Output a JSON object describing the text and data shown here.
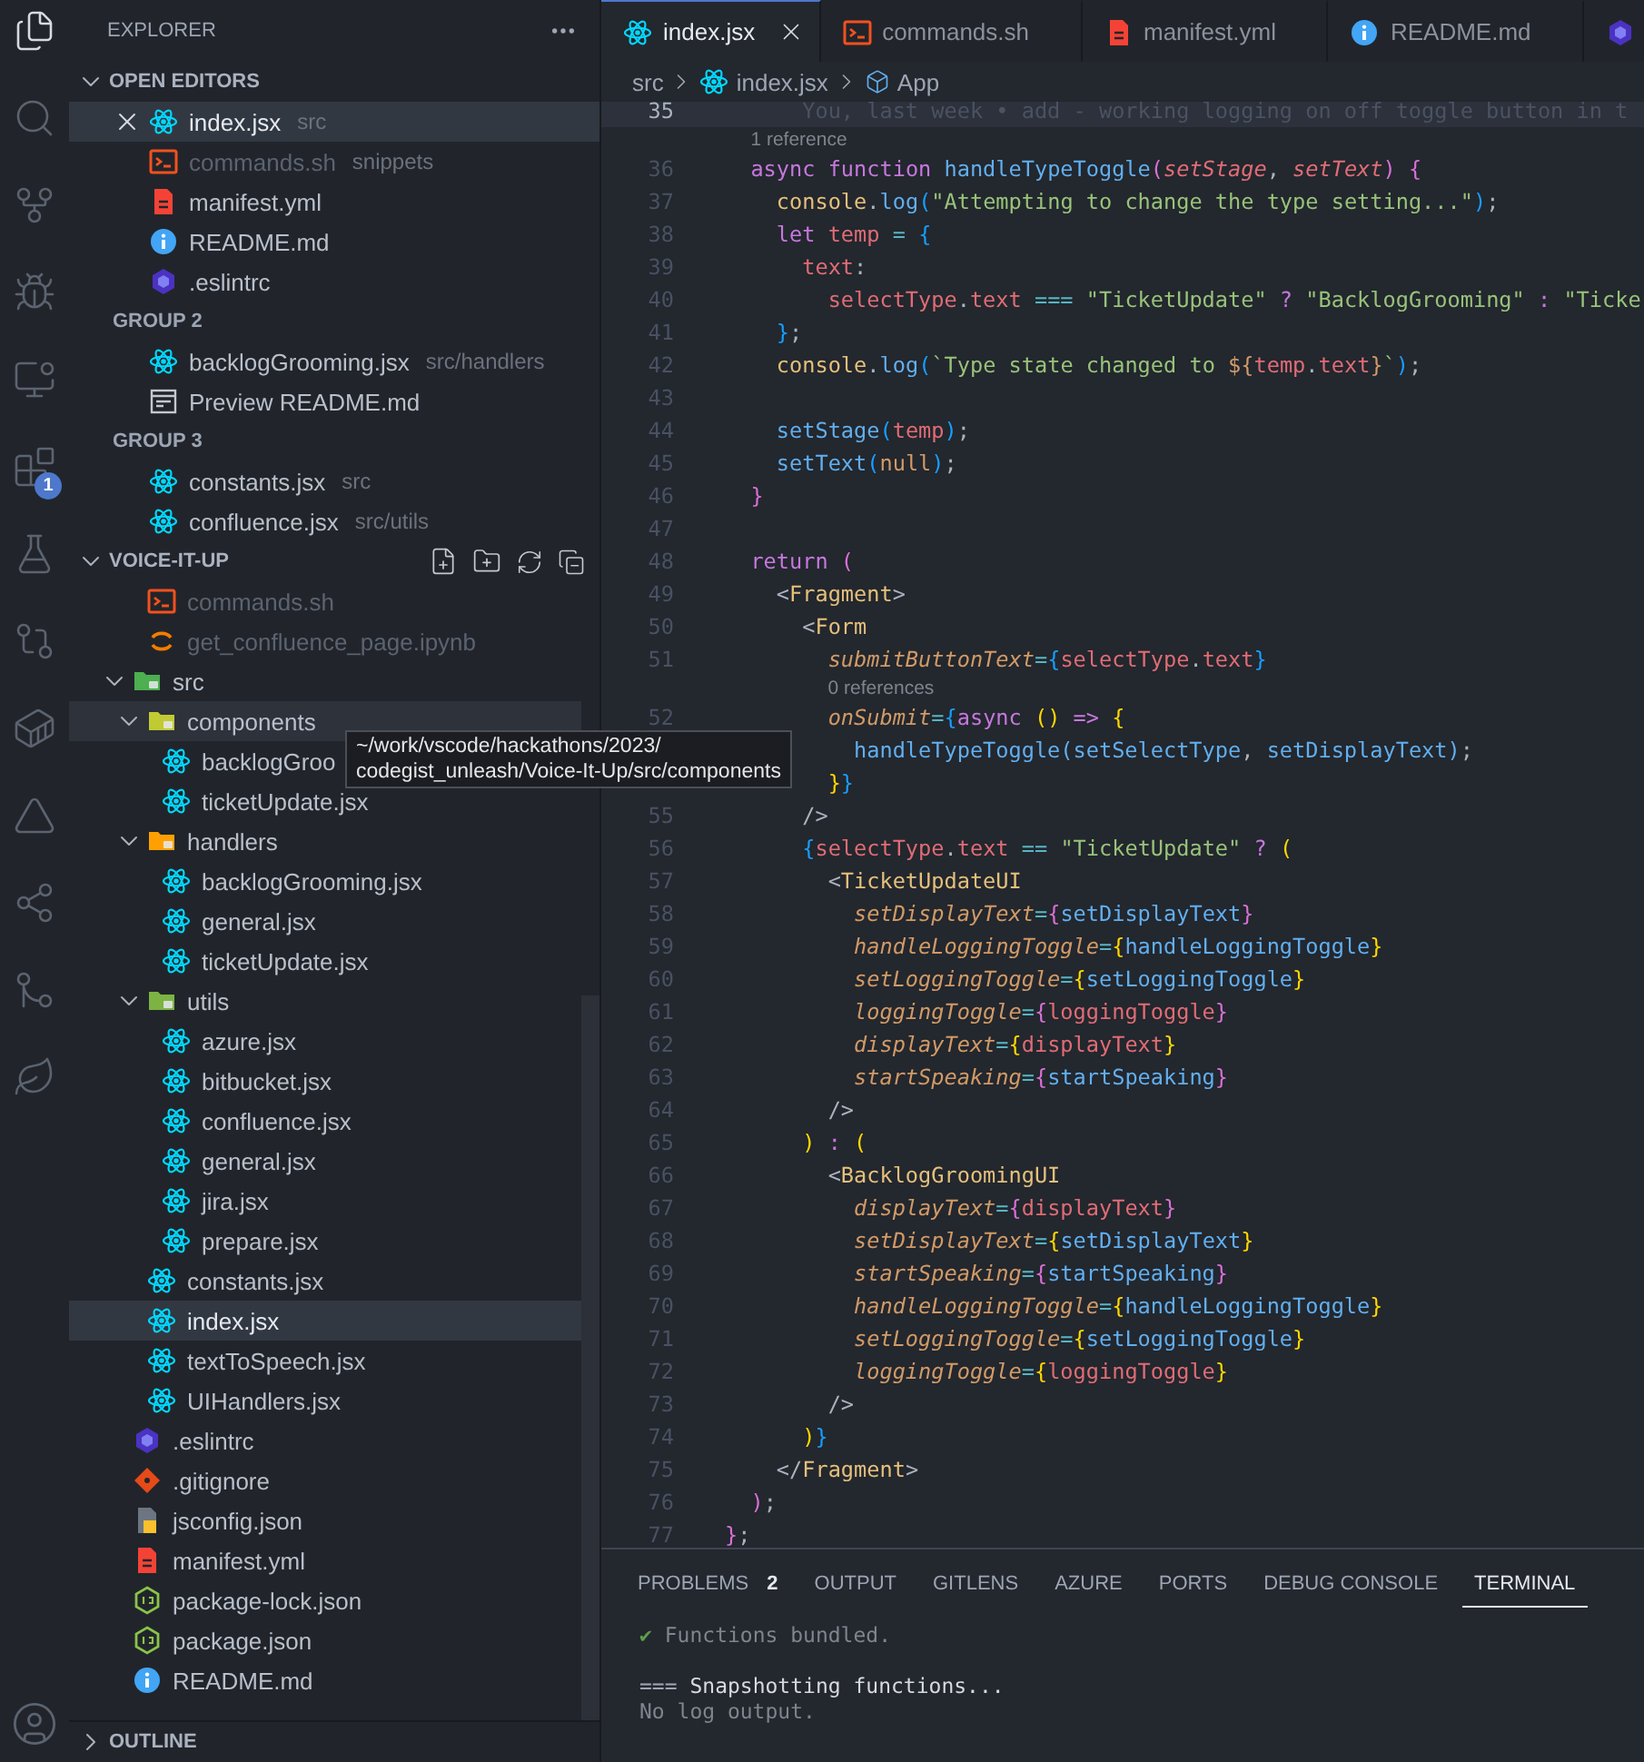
{
  "activity_bar": {
    "items": [
      {
        "kind": "files",
        "selected": true
      },
      {
        "kind": "search",
        "selected": false
      },
      {
        "kind": "source-control",
        "selected": false
      },
      {
        "kind": "debug",
        "selected": false
      },
      {
        "kind": "remote",
        "selected": false
      },
      {
        "kind": "extensions",
        "selected": false,
        "badge": "1"
      },
      {
        "kind": "testing",
        "selected": false
      },
      {
        "kind": "gitlens",
        "selected": false
      },
      {
        "kind": "docker",
        "selected": false
      },
      {
        "kind": "azure",
        "selected": false
      },
      {
        "kind": "liveshare",
        "selected": false
      },
      {
        "kind": "gitgraph",
        "selected": false
      },
      {
        "kind": "mongo",
        "selected": false
      }
    ]
  },
  "sidebar": {
    "title": "EXPLORER",
    "open_editors": {
      "title": "OPEN EDITORS",
      "expanded": true,
      "groups": [
        {
          "items": [
            {
              "name": "index.jsx",
              "detail": "src",
              "kind": "react",
              "selected": true,
              "dimmed": false
            },
            {
              "name": "commands.sh",
              "detail": "snippets",
              "kind": "terminal",
              "selected": false,
              "dimmed": true
            },
            {
              "name": "manifest.yml",
              "kind": "yaml",
              "selected": false,
              "dimmed": false
            },
            {
              "name": "README.md",
              "kind": "info",
              "selected": false,
              "dimmed": false
            },
            {
              "name": ".eslintrc",
              "kind": "eslint",
              "selected": false,
              "dimmed": false
            }
          ]
        },
        {
          "label": "GROUP 2",
          "items": [
            {
              "name": "backlogGrooming.jsx",
              "detail": "src/handlers",
              "kind": "react",
              "selected": false,
              "dimmed": false
            },
            {
              "name": "Preview README.md",
              "kind": "preview",
              "selected": false,
              "dimmed": false
            }
          ]
        },
        {
          "label": "GROUP 3",
          "items": [
            {
              "name": "constants.jsx",
              "detail": "src",
              "kind": "react",
              "selected": false,
              "dimmed": false
            },
            {
              "name": "confluence.jsx",
              "detail": "src/utils",
              "kind": "react",
              "selected": false,
              "dimmed": false
            }
          ]
        }
      ]
    },
    "folder": {
      "title": "VOICE-IT-UP",
      "expanded": true,
      "tree": [
        {
          "kind": "folder",
          "children": [
            {
              "kind": "terminal",
              "name": "commands.sh",
              "selected": false,
              "dimmed": true,
              "hovered": false
            },
            {
              "kind": "notebook",
              "name": "get_confluence_page.ipynb",
              "selected": false,
              "dimmed": true,
              "hovered": false
            }
          ]
        },
        {
          "kind": "folder",
          "name": "src",
          "color": "#4caf50",
          "expanded": true,
          "selected": false,
          "dimmed": false,
          "hovered": false,
          "children": [
            {
              "kind": "folder",
              "name": "components",
              "color": "#c0ca33",
              "expanded": true,
              "selected": false,
              "dimmed": false,
              "hovered": true,
              "children": [
                {
                  "kind": "react",
                  "name": "backlogGroo",
                  "selected": false,
                  "dimmed": false,
                  "hovered": false
                },
                {
                  "kind": "react",
                  "name": "ticketUpdate.jsx",
                  "selected": false,
                  "dimmed": false,
                  "hovered": false
                }
              ]
            },
            {
              "kind": "folder",
              "name": "handlers",
              "color": "#ffa000",
              "expanded": true,
              "selected": false,
              "dimmed": false,
              "hovered": false,
              "children": [
                {
                  "kind": "react",
                  "name": "backlogGrooming.jsx",
                  "selected": false,
                  "dimmed": false,
                  "hovered": false
                },
                {
                  "kind": "react",
                  "name": "general.jsx",
                  "selected": false,
                  "dimmed": false,
                  "hovered": false
                },
                {
                  "kind": "react",
                  "name": "ticketUpdate.jsx",
                  "selected": false,
                  "dimmed": false,
                  "hovered": false
                }
              ]
            },
            {
              "kind": "folder",
              "name": "utils",
              "color": "#7cb342",
              "expanded": true,
              "selected": false,
              "dimmed": false,
              "hovered": false,
              "children": [
                {
                  "kind": "react",
                  "name": "azure.jsx",
                  "selected": false,
                  "dimmed": false,
                  "hovered": false
                },
                {
                  "kind": "react",
                  "name": "bitbucket.jsx",
                  "selected": false,
                  "dimmed": false,
                  "hovered": false
                },
                {
                  "kind": "react",
                  "name": "confluence.jsx",
                  "selected": false,
                  "dimmed": false,
                  "hovered": false
                },
                {
                  "kind": "react",
                  "name": "general.jsx",
                  "selected": false,
                  "dimmed": false,
                  "hovered": false
                },
                {
                  "kind": "react",
                  "name": "jira.jsx",
                  "selected": false,
                  "dimmed": false,
                  "hovered": false
                },
                {
                  "kind": "react",
                  "name": "prepare.jsx",
                  "selected": false,
                  "dimmed": false,
                  "hovered": false
                }
              ]
            },
            {
              "kind": "react",
              "name": "constants.jsx",
              "selected": false,
              "dimmed": false,
              "hovered": false
            },
            {
              "kind": "react",
              "name": "index.jsx",
              "selected": true,
              "dimmed": false,
              "hovered": false
            },
            {
              "kind": "react",
              "name": "textToSpeech.jsx",
              "selected": false,
              "dimmed": false,
              "hovered": false
            },
            {
              "kind": "react",
              "name": "UIHandlers.jsx",
              "selected": false,
              "dimmed": false,
              "hovered": false
            }
          ]
        },
        {
          "kind": "eslint",
          "name": ".eslintrc",
          "selected": false,
          "dimmed": false,
          "hovered": false
        },
        {
          "kind": "git",
          "name": ".gitignore",
          "selected": false,
          "dimmed": false,
          "hovered": false
        },
        {
          "kind": "jsconfig",
          "name": "jsconfig.json",
          "selected": false,
          "dimmed": false,
          "hovered": false
        },
        {
          "kind": "yaml",
          "name": "manifest.yml",
          "selected": false,
          "dimmed": false,
          "hovered": false
        },
        {
          "kind": "node",
          "name": "package-lock.json",
          "selected": false,
          "dimmed": false,
          "hovered": false
        },
        {
          "kind": "node",
          "name": "package.json",
          "selected": false,
          "dimmed": false,
          "hovered": false
        },
        {
          "kind": "info",
          "name": "README.md",
          "selected": false,
          "dimmed": false,
          "hovered": false
        }
      ]
    },
    "outline": {
      "title": "OUTLINE",
      "expanded": false
    }
  },
  "tooltip": {
    "lines": [
      "~/work/vscode/hackathons/2023/",
      "codegist_unleash/Voice-It-Up/src/components"
    ]
  },
  "editor": {
    "tabs": [
      {
        "label": "index.jsx",
        "kind": "react",
        "selected": true
      },
      {
        "label": "commands.sh",
        "kind": "terminal",
        "selected": false
      },
      {
        "label": "manifest.yml",
        "kind": "yaml",
        "selected": false
      },
      {
        "label": "README.md",
        "kind": "info",
        "selected": false
      },
      {
        "kind": "eslint",
        "selected": false
      }
    ],
    "breadcrumb": [
      {
        "kind": "folder",
        "text": "src"
      },
      {
        "kind": "react",
        "text": "index.jsx"
      },
      {
        "kind": "symbol",
        "text": "App"
      }
    ],
    "lines": [
      {
        "kind": "code",
        "number": "35",
        "current": true,
        "tokens": [
          {
            "kind": "blame",
            "text": "      You, last week • add - working logging on off toggle button in t"
          }
        ]
      },
      {
        "kind": "lens",
        "text": "1 reference"
      },
      {
        "kind": "code",
        "number": "36",
        "current": false,
        "tokens": [
          {
            "kind": "kw",
            "text": "  async "
          },
          {
            "kind": "kw",
            "text": "function "
          },
          {
            "kind": "fn",
            "text": "handleTypeToggle"
          },
          {
            "kind": "b2",
            "text": "("
          },
          {
            "kind": "param",
            "text": "setStage"
          },
          {
            "kind": "punct",
            "text": ", "
          },
          {
            "kind": "param",
            "text": "setText"
          },
          {
            "kind": "b2",
            "text": ")"
          },
          {
            "kind": "b2",
            "text": " {"
          }
        ]
      },
      {
        "kind": "code",
        "number": "37",
        "current": false,
        "tokens": [
          {
            "kind": "obj",
            "text": "    console"
          },
          {
            "kind": "punct",
            "text": "."
          },
          {
            "kind": "fn",
            "text": "log"
          },
          {
            "kind": "b3",
            "text": "("
          },
          {
            "kind": "str",
            "text": "\"Attempting to change the type setting...\""
          },
          {
            "kind": "b3",
            "text": ")"
          },
          {
            "kind": "punct",
            "text": ";"
          }
        ]
      },
      {
        "kind": "code",
        "number": "38",
        "current": false,
        "tokens": [
          {
            "kind": "kw",
            "text": "    let "
          },
          {
            "kind": "var",
            "text": "temp"
          },
          {
            "kind": "op",
            "text": " = "
          },
          {
            "kind": "b3",
            "text": "{"
          }
        ]
      },
      {
        "kind": "code",
        "number": "39",
        "current": false,
        "tokens": [
          {
            "kind": "var",
            "text": "      text"
          },
          {
            "kind": "punct",
            "text": ":"
          }
        ]
      },
      {
        "kind": "code",
        "number": "40",
        "current": false,
        "tokens": [
          {
            "kind": "var",
            "text": "        selectType"
          },
          {
            "kind": "punct",
            "text": "."
          },
          {
            "kind": "var",
            "text": "text"
          },
          {
            "kind": "op",
            "text": " === "
          },
          {
            "kind": "str",
            "text": "\"TicketUpdate\""
          },
          {
            "kind": "kw",
            "text": " ? "
          },
          {
            "kind": "str",
            "text": "\"BacklogGrooming\""
          },
          {
            "kind": "kw",
            "text": " : "
          },
          {
            "kind": "str",
            "text": "\"Ticke"
          }
        ]
      },
      {
        "kind": "code",
        "number": "41",
        "current": false,
        "tokens": [
          {
            "kind": "b3",
            "text": "    }"
          },
          {
            "kind": "punct",
            "text": ";"
          }
        ]
      },
      {
        "kind": "code",
        "number": "42",
        "current": false,
        "tokens": [
          {
            "kind": "obj",
            "text": "    console"
          },
          {
            "kind": "punct",
            "text": "."
          },
          {
            "kind": "fn",
            "text": "log"
          },
          {
            "kind": "b3",
            "text": "("
          },
          {
            "kind": "str",
            "text": "`Type state changed to "
          },
          {
            "kind": "tmpl",
            "text": "${"
          },
          {
            "kind": "var",
            "text": "temp"
          },
          {
            "kind": "punct",
            "text": "."
          },
          {
            "kind": "var",
            "text": "text"
          },
          {
            "kind": "tmpl",
            "text": "}"
          },
          {
            "kind": "str",
            "text": "`"
          },
          {
            "kind": "b3",
            "text": ")"
          },
          {
            "kind": "punct",
            "text": ";"
          }
        ]
      },
      {
        "kind": "code",
        "number": "43",
        "current": false
      },
      {
        "kind": "code",
        "number": "44",
        "current": false,
        "tokens": [
          {
            "kind": "fn",
            "text": "    setStage"
          },
          {
            "kind": "b3",
            "text": "("
          },
          {
            "kind": "var",
            "text": "temp"
          },
          {
            "kind": "b3",
            "text": ")"
          },
          {
            "kind": "punct",
            "text": ";"
          }
        ]
      },
      {
        "kind": "code",
        "number": "45",
        "current": false,
        "tokens": [
          {
            "kind": "fn",
            "text": "    setText"
          },
          {
            "kind": "b3",
            "text": "("
          },
          {
            "kind": "const",
            "text": "null"
          },
          {
            "kind": "b3",
            "text": ")"
          },
          {
            "kind": "punct",
            "text": ";"
          }
        ]
      },
      {
        "kind": "code",
        "number": "46",
        "current": false,
        "tokens": [
          {
            "kind": "b2",
            "text": "  }"
          }
        ]
      },
      {
        "kind": "code",
        "number": "47",
        "current": false
      },
      {
        "kind": "code",
        "number": "48",
        "current": false,
        "tokens": [
          {
            "kind": "kw",
            "text": "  return "
          },
          {
            "kind": "b2",
            "text": "("
          }
        ]
      },
      {
        "kind": "code",
        "number": "49",
        "current": false,
        "tokens": [
          {
            "kind": "punct",
            "text": "    <"
          },
          {
            "kind": "tag",
            "text": "Fragment"
          },
          {
            "kind": "punct",
            "text": ">"
          }
        ]
      },
      {
        "kind": "code",
        "number": "50",
        "current": false,
        "tokens": [
          {
            "kind": "punct",
            "text": "      <"
          },
          {
            "kind": "tag",
            "text": "Form"
          }
        ]
      },
      {
        "kind": "code",
        "number": "51",
        "current": false,
        "tokens": [
          {
            "kind": "attr",
            "text": "        submitButtonText"
          },
          {
            "kind": "op",
            "text": "="
          },
          {
            "kind": "b3",
            "text": "{"
          },
          {
            "kind": "var",
            "text": "selectType"
          },
          {
            "kind": "punct",
            "text": "."
          },
          {
            "kind": "var",
            "text": "text"
          },
          {
            "kind": "b3",
            "text": "}"
          }
        ]
      },
      {
        "kind": "lens",
        "text": "0 references"
      },
      {
        "kind": "code",
        "number": "52",
        "current": false,
        "tokens": [
          {
            "kind": "attr",
            "text": "        onSubmit"
          },
          {
            "kind": "op",
            "text": "="
          },
          {
            "kind": "b3",
            "text": "{"
          },
          {
            "kind": "kw",
            "text": "async "
          },
          {
            "kind": "b1",
            "text": "() "
          },
          {
            "kind": "kw",
            "text": "=> "
          },
          {
            "kind": "b1",
            "text": "{"
          }
        ]
      },
      {
        "kind": "code",
        "current": false,
        "tokens": [
          {
            "kind": "fn",
            "text": "          handleTypeToggle(setSelectType"
          },
          {
            "kind": "punct",
            "text": ", "
          },
          {
            "kind": "fn",
            "text": "setDisplayText)"
          },
          {
            "kind": "punct",
            "text": ";"
          }
        ]
      },
      {
        "kind": "code",
        "current": false,
        "tokens": [
          {
            "kind": "b1",
            "text": "        }"
          },
          {
            "kind": "b3",
            "text": "}"
          }
        ]
      },
      {
        "kind": "code",
        "number": "55",
        "current": false,
        "tokens": [
          {
            "kind": "punct",
            "text": "      />"
          }
        ]
      },
      {
        "kind": "code",
        "number": "56",
        "current": false,
        "tokens": [
          {
            "kind": "b3",
            "text": "      {"
          },
          {
            "kind": "var",
            "text": "selectType"
          },
          {
            "kind": "punct",
            "text": "."
          },
          {
            "kind": "var",
            "text": "text"
          },
          {
            "kind": "op",
            "text": " == "
          },
          {
            "kind": "str",
            "text": "\"TicketUpdate\""
          },
          {
            "kind": "kw",
            "text": " ? "
          },
          {
            "kind": "b1",
            "text": "("
          }
        ]
      },
      {
        "kind": "code",
        "number": "57",
        "current": false,
        "tokens": [
          {
            "kind": "punct",
            "text": "        <"
          },
          {
            "kind": "tag",
            "text": "TicketUpdateUI"
          }
        ]
      },
      {
        "kind": "code",
        "number": "58",
        "current": false,
        "tokens": [
          {
            "kind": "attr",
            "text": "          setDisplayText"
          },
          {
            "kind": "op",
            "text": "="
          },
          {
            "kind": "b2",
            "text": "{"
          },
          {
            "kind": "fn",
            "text": "setDisplayText"
          },
          {
            "kind": "b2",
            "text": "}"
          }
        ]
      },
      {
        "kind": "code",
        "number": "59",
        "current": false,
        "tokens": [
          {
            "kind": "attr",
            "text": "          handleLoggingToggle"
          },
          {
            "kind": "op",
            "text": "="
          },
          {
            "kind": "b1",
            "text": "{"
          },
          {
            "kind": "fn",
            "text": "handleLoggingToggle"
          },
          {
            "kind": "b1",
            "text": "}"
          }
        ]
      },
      {
        "kind": "code",
        "number": "60",
        "current": false,
        "tokens": [
          {
            "kind": "attr",
            "text": "          setLoggingToggle"
          },
          {
            "kind": "op",
            "text": "="
          },
          {
            "kind": "b1",
            "text": "{"
          },
          {
            "kind": "fn",
            "text": "setLoggingToggle"
          },
          {
            "kind": "b1",
            "text": "}"
          }
        ]
      },
      {
        "kind": "code",
        "number": "61",
        "current": false,
        "tokens": [
          {
            "kind": "attr",
            "text": "          loggingToggle"
          },
          {
            "kind": "op",
            "text": "="
          },
          {
            "kind": "b2",
            "text": "{"
          },
          {
            "kind": "var",
            "text": "loggingToggle"
          },
          {
            "kind": "b2",
            "text": "}"
          }
        ]
      },
      {
        "kind": "code",
        "number": "62",
        "current": false,
        "tokens": [
          {
            "kind": "attr",
            "text": "          displayText"
          },
          {
            "kind": "op",
            "text": "="
          },
          {
            "kind": "b1",
            "text": "{"
          },
          {
            "kind": "var",
            "text": "displayText"
          },
          {
            "kind": "b1",
            "text": "}"
          }
        ]
      },
      {
        "kind": "code",
        "number": "63",
        "current": false,
        "tokens": [
          {
            "kind": "attr",
            "text": "          startSpeaking"
          },
          {
            "kind": "op",
            "text": "="
          },
          {
            "kind": "b2",
            "text": "{"
          },
          {
            "kind": "fn",
            "text": "startSpeaking"
          },
          {
            "kind": "b2",
            "text": "}"
          }
        ]
      },
      {
        "kind": "code",
        "number": "64",
        "current": false,
        "tokens": [
          {
            "kind": "punct",
            "text": "        />"
          }
        ]
      },
      {
        "kind": "code",
        "number": "65",
        "current": false,
        "tokens": [
          {
            "kind": "b1",
            "text": "      )"
          },
          {
            "kind": "kw",
            "text": " : "
          },
          {
            "kind": "b1",
            "text": "("
          }
        ]
      },
      {
        "kind": "code",
        "number": "66",
        "current": false,
        "tokens": [
          {
            "kind": "punct",
            "text": "        <"
          },
          {
            "kind": "tag",
            "text": "BacklogGroomingUI"
          }
        ]
      },
      {
        "kind": "code",
        "number": "67",
        "current": false,
        "tokens": [
          {
            "kind": "attr",
            "text": "          displayText"
          },
          {
            "kind": "op",
            "text": "="
          },
          {
            "kind": "b2",
            "text": "{"
          },
          {
            "kind": "var",
            "text": "displayText"
          },
          {
            "kind": "b2",
            "text": "}"
          }
        ]
      },
      {
        "kind": "code",
        "number": "68",
        "current": false,
        "tokens": [
          {
            "kind": "attr",
            "text": "          setDisplayText"
          },
          {
            "kind": "op",
            "text": "="
          },
          {
            "kind": "b1",
            "text": "{"
          },
          {
            "kind": "fn",
            "text": "setDisplayText"
          },
          {
            "kind": "b1",
            "text": "}"
          }
        ]
      },
      {
        "kind": "code",
        "number": "69",
        "current": false,
        "tokens": [
          {
            "kind": "attr",
            "text": "          startSpeaking"
          },
          {
            "kind": "op",
            "text": "="
          },
          {
            "kind": "b2",
            "text": "{"
          },
          {
            "kind": "fn",
            "text": "startSpeaking"
          },
          {
            "kind": "b2",
            "text": "}"
          }
        ]
      },
      {
        "kind": "code",
        "number": "70",
        "current": false,
        "tokens": [
          {
            "kind": "attr",
            "text": "          handleLoggingToggle"
          },
          {
            "kind": "op",
            "text": "="
          },
          {
            "kind": "b1",
            "text": "{"
          },
          {
            "kind": "fn",
            "text": "handleLoggingToggle"
          },
          {
            "kind": "b1",
            "text": "}"
          }
        ]
      },
      {
        "kind": "code",
        "number": "71",
        "current": false,
        "tokens": [
          {
            "kind": "attr",
            "text": "          setLoggingToggle"
          },
          {
            "kind": "op",
            "text": "="
          },
          {
            "kind": "b1",
            "text": "{"
          },
          {
            "kind": "fn",
            "text": "setLoggingToggle"
          },
          {
            "kind": "b1",
            "text": "}"
          }
        ]
      },
      {
        "kind": "code",
        "number": "72",
        "current": false,
        "tokens": [
          {
            "kind": "attr",
            "text": "          loggingToggle"
          },
          {
            "kind": "op",
            "text": "="
          },
          {
            "kind": "b1",
            "text": "{"
          },
          {
            "kind": "var",
            "text": "loggingToggle"
          },
          {
            "kind": "b1",
            "text": "}"
          }
        ]
      },
      {
        "kind": "code",
        "number": "73",
        "current": false,
        "tokens": [
          {
            "kind": "punct",
            "text": "        />"
          }
        ]
      },
      {
        "kind": "code",
        "number": "74",
        "current": false,
        "tokens": [
          {
            "kind": "b1",
            "text": "      )"
          },
          {
            "kind": "b3",
            "text": "}"
          }
        ]
      },
      {
        "kind": "code",
        "number": "75",
        "current": false,
        "tokens": [
          {
            "kind": "punct",
            "text": "    </"
          },
          {
            "kind": "tag",
            "text": "Fragment"
          },
          {
            "kind": "punct",
            "text": ">"
          }
        ]
      },
      {
        "kind": "code",
        "number": "76",
        "current": false,
        "tokens": [
          {
            "kind": "b2",
            "text": "  )"
          },
          {
            "kind": "punct",
            "text": ";"
          }
        ]
      },
      {
        "kind": "code",
        "number": "77",
        "current": false,
        "tokens": [
          {
            "kind": "b2",
            "text": "}"
          },
          {
            "kind": "punct",
            "text": ";"
          }
        ]
      }
    ]
  },
  "panel": {
    "tabs": [
      {
        "label": "PROBLEMS",
        "badge": "2",
        "selected": false
      },
      {
        "label": "OUTPUT",
        "selected": false
      },
      {
        "label": "GITLENS",
        "selected": false
      },
      {
        "label": "AZURE",
        "selected": false
      },
      {
        "label": "PORTS",
        "selected": false
      },
      {
        "label": "DEBUG CONSOLE",
        "selected": false
      },
      {
        "label": "TERMINAL",
        "selected": true
      }
    ],
    "terminal": [
      {
        "kind": "success",
        "mark": "✔",
        "text": "Functions bundled."
      },
      {
        "kind": "blank"
      },
      {
        "kind": "heading",
        "mark": "===",
        "text": "Snapshotting functions..."
      },
      {
        "kind": "muted",
        "text": "No log output."
      }
    ]
  }
}
